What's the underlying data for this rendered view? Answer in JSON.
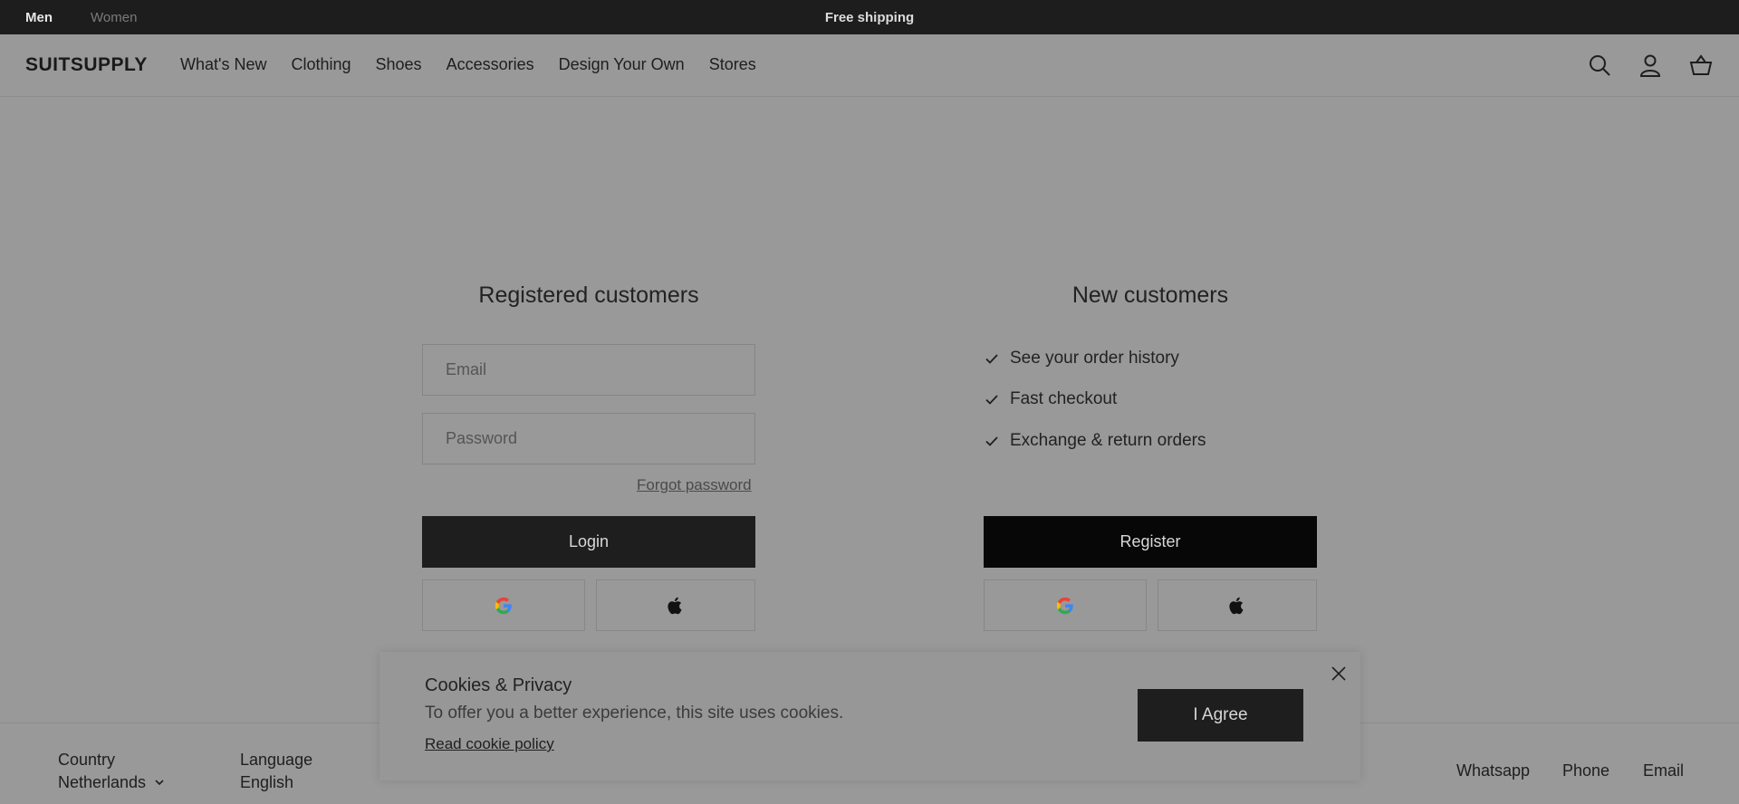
{
  "topbar": {
    "men": "Men",
    "women": "Women",
    "promo": "Free shipping"
  },
  "nav": {
    "logo": "SUITSUPPLY",
    "items": [
      "What's New",
      "Clothing",
      "Shoes",
      "Accessories",
      "Design Your Own",
      "Stores"
    ],
    "icons": [
      "search-icon",
      "account-icon",
      "basket-icon"
    ]
  },
  "login": {
    "title": "Registered customers",
    "email_placeholder": "Email",
    "password_placeholder": "Password",
    "forgot": "Forgot password",
    "button": "Login"
  },
  "register": {
    "title": "New customers",
    "benefits": [
      "See your order history",
      "Fast checkout",
      "Exchange & return orders"
    ],
    "button": "Register"
  },
  "footer": {
    "country_label": "Country",
    "country_value": "Netherlands",
    "language_label": "Language",
    "language_value": "English",
    "contact": [
      "Whatsapp",
      "Phone",
      "Email"
    ]
  },
  "cookie": {
    "title": "Cookies & Privacy",
    "text": "To offer you a better experience, this site uses cookies.",
    "link": "Read cookie policy",
    "button": "I Agree"
  },
  "colors": {
    "overlay_bg": "#999999",
    "topbar_bg": "#1d1d1d",
    "button_dark": "#1e1e1e"
  }
}
